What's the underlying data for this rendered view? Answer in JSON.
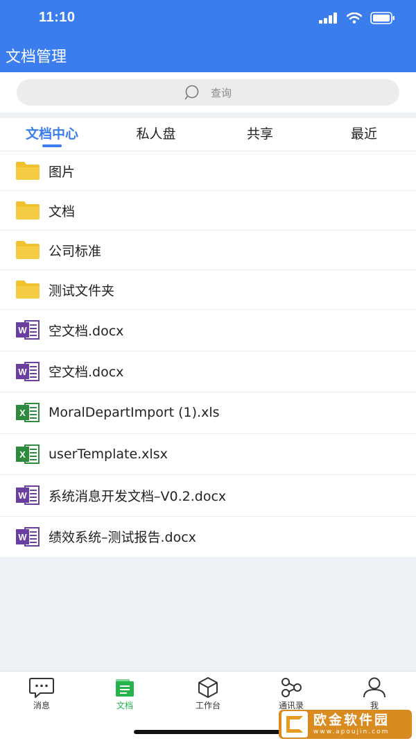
{
  "status_bar": {
    "time": "11:10"
  },
  "header": {
    "title": "文档管理"
  },
  "search": {
    "placeholder": "查询"
  },
  "tabs": [
    {
      "label": "文档中心",
      "active": true
    },
    {
      "label": "私人盘",
      "active": false
    },
    {
      "label": "共享",
      "active": false
    },
    {
      "label": "最近",
      "active": false
    }
  ],
  "files": [
    {
      "name": "图片",
      "type": "folder"
    },
    {
      "name": "文档",
      "type": "folder"
    },
    {
      "name": "公司标准",
      "type": "folder"
    },
    {
      "name": "测试文件夹",
      "type": "folder"
    },
    {
      "name": "空文档.docx",
      "type": "word"
    },
    {
      "name": "空文档.docx",
      "type": "word"
    },
    {
      "name": "MoralDepartImport (1).xls",
      "type": "excel"
    },
    {
      "name": "userTemplate.xlsx",
      "type": "excel"
    },
    {
      "name": "系统消息开发文档–V0.2.docx",
      "type": "word"
    },
    {
      "name": "绩效系统–测试报告.docx",
      "type": "word"
    }
  ],
  "bottom_nav": [
    {
      "label": "消息",
      "icon": "message-icon",
      "active": false
    },
    {
      "label": "文档",
      "icon": "document-icon",
      "active": true
    },
    {
      "label": "工作台",
      "icon": "cube-icon",
      "active": false
    },
    {
      "label": "通讯录",
      "icon": "contacts-network-icon",
      "active": false
    },
    {
      "label": "我",
      "icon": "person-icon",
      "active": false
    }
  ],
  "icons": {
    "folder": "folder-icon",
    "word": "word-doc-icon",
    "excel": "excel-sheet-icon",
    "word_letter": "W",
    "excel_letter": "X"
  },
  "colors": {
    "primary": "#3b7ded",
    "folder": "#f2c12e",
    "word": "#6b3fa0",
    "excel": "#2e8b3d",
    "nav_active": "#25b34b"
  },
  "watermark": {
    "title": "欧金软件园",
    "subtitle": "www.apoujin.com"
  }
}
